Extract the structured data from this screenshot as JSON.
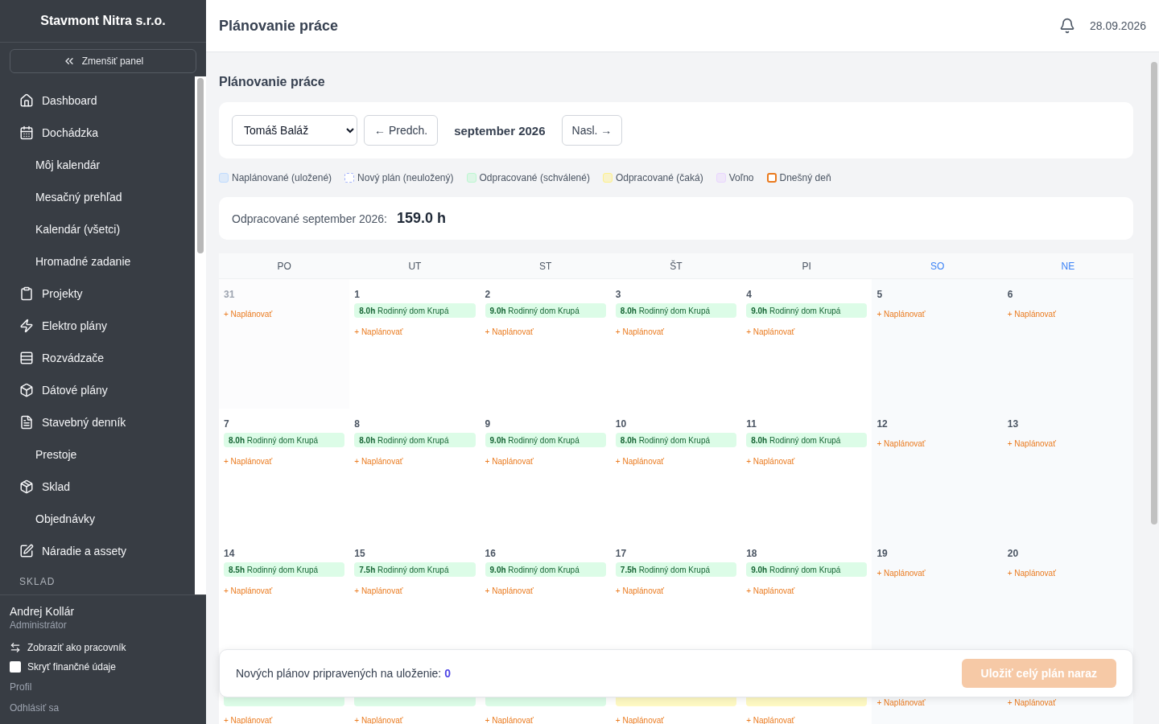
{
  "sidebar": {
    "company": "Stavmont Nitra s.r.o.",
    "collapse_button": "Zmenšiť panel",
    "items": [
      {
        "label": "Dashboard",
        "kind": "main"
      },
      {
        "label": "Dochádzka",
        "kind": "main"
      },
      {
        "label": "Môj kalendár",
        "kind": "sub"
      },
      {
        "label": "Mesačný prehľad",
        "kind": "sub"
      },
      {
        "label": "Kalendár (všetci)",
        "kind": "sub"
      },
      {
        "label": "Hromadné zadanie",
        "kind": "sub"
      },
      {
        "label": "Projekty",
        "kind": "main"
      },
      {
        "label": "Elektro plány",
        "kind": "main"
      },
      {
        "label": "Rozvádzače",
        "kind": "main"
      },
      {
        "label": "Dátové plány",
        "kind": "main"
      },
      {
        "label": "Stavebný denník",
        "kind": "main"
      },
      {
        "label": "Prestoje",
        "kind": "sub"
      },
      {
        "label": "Sklad",
        "kind": "main"
      },
      {
        "label": "Objednávky",
        "kind": "sub"
      },
      {
        "label": "Náradie a assety",
        "kind": "main"
      },
      {
        "label": "SKLAD",
        "kind": "section"
      }
    ],
    "user": {
      "name": "Andrej Kollár",
      "role": "Administrátor",
      "switch_link": "Zobraziť ako pracovník",
      "hide_finance": {
        "label": "Skryť finančné údaje",
        "checked": false
      },
      "links": [
        "Profil",
        "Odhlásiť sa"
      ]
    }
  },
  "header": {
    "title": "Plánovanie práce",
    "date": "28.09.2026"
  },
  "page_title": "Plánovanie práce",
  "toolbar": {
    "employee": "Tomáš Baláž",
    "prev_button": "← Predch.",
    "month": "september 2026",
    "next_button": "Nasl. →"
  },
  "legend": [
    {
      "label": "Naplánované (uložené)",
      "color": "#bfdbfe",
      "kind": "solid"
    },
    {
      "label": "Nový plán (neuložený)",
      "color": "#a5b4fc",
      "kind": "dashed"
    },
    {
      "label": "Odpracované (schválené)",
      "color": "#bbf7d0",
      "kind": "solid"
    },
    {
      "label": "Odpracované (čaká)",
      "color": "#fef08a",
      "kind": "solid"
    },
    {
      "label": "Voľno",
      "color": "#e9d5ff",
      "kind": "solid"
    },
    {
      "label": "Dnešný deň",
      "color": "#ea7a1e",
      "kind": "outline"
    }
  ],
  "summary": {
    "label": "Odpracované september 2026:",
    "value": "159.0 h"
  },
  "calendar": {
    "weekdays": [
      {
        "label": "PO",
        "weekend": false
      },
      {
        "label": "UT",
        "weekend": false
      },
      {
        "label": "ST",
        "weekend": false
      },
      {
        "label": "ŠT",
        "weekend": false
      },
      {
        "label": "PI",
        "weekend": false
      },
      {
        "label": "SO",
        "weekend": true
      },
      {
        "label": "NE",
        "weekend": true
      }
    ],
    "weeks": [
      [
        {
          "day": "31",
          "other_month": true,
          "add": "+ Naplánovať"
        },
        {
          "day": "1",
          "other_month": false,
          "entries": [
            {
              "text": "**8.0h** Rodinný dom Krupá",
              "kind": "approved"
            }
          ],
          "add": "+ Naplánovať"
        },
        {
          "day": "2",
          "other_month": false,
          "entries": [
            {
              "text": "**9.0h** Rodinný dom Krupá",
              "kind": "approved"
            }
          ],
          "add": "+ Naplánovať"
        },
        {
          "day": "3",
          "other_month": false,
          "entries": [
            {
              "text": "**8.0h** Rodinný dom Krupá",
              "kind": "approved"
            }
          ],
          "add": "+ Naplánovať"
        },
        {
          "day": "4",
          "other_month": false,
          "entries": [
            {
              "text": "**9.0h** Rodinný dom Krupá",
              "kind": "approved"
            }
          ],
          "add": "+ Naplánovať"
        },
        {
          "day": "5",
          "other_month": false,
          "add": "+ Naplánovať"
        },
        {
          "day": "6",
          "other_month": false,
          "add": "+ Naplánovať"
        }
      ],
      [
        {
          "day": "7",
          "other_month": false,
          "entries": [
            {
              "text": "**8.0h** Rodinný dom Krupá",
              "kind": "approved"
            }
          ],
          "add": "+ Naplánovať"
        },
        {
          "day": "8",
          "other_month": false,
          "entries": [
            {
              "text": "**8.0h** Rodinný dom Krupá",
              "kind": "approved"
            }
          ],
          "add": "+ Naplánovať"
        },
        {
          "day": "9",
          "other_month": false,
          "entries": [
            {
              "text": "**9.0h** Rodinný dom Krupá",
              "kind": "approved"
            }
          ],
          "add": "+ Naplánovať"
        },
        {
          "day": "10",
          "other_month": false,
          "entries": [
            {
              "text": "**8.0h** Rodinný dom Krupá",
              "kind": "approved"
            }
          ],
          "add": "+ Naplánovať"
        },
        {
          "day": "11",
          "other_month": false,
          "entries": [
            {
              "text": "**8.0h** Rodinný dom Krupá",
              "kind": "approved"
            }
          ],
          "add": "+ Naplánovať"
        },
        {
          "day": "12",
          "other_month": false,
          "add": "+ Naplánovať"
        },
        {
          "day": "13",
          "other_month": false,
          "add": "+ Naplánovať"
        }
      ],
      [
        {
          "day": "14",
          "other_month": false,
          "entries": [
            {
              "text": "**8.5h** Rodinný dom Krupá",
              "kind": "approved"
            }
          ],
          "add": "+ Naplánovať"
        },
        {
          "day": "15",
          "other_month": false,
          "entries": [
            {
              "text": "**7.5h** Rodinný dom Krupá",
              "kind": "approved"
            }
          ],
          "add": "+ Naplánovať"
        },
        {
          "day": "16",
          "other_month": false,
          "entries": [
            {
              "text": "**9.0h** Rodinný dom Krupá",
              "kind": "approved"
            }
          ],
          "add": "+ Naplánovať"
        },
        {
          "day": "17",
          "other_month": false,
          "entries": [
            {
              "text": "**7.5h** Rodinný dom Krupá",
              "kind": "approved"
            }
          ],
          "add": "+ Naplánovať"
        },
        {
          "day": "18",
          "other_month": false,
          "entries": [
            {
              "text": "**9.0h** Rodinný dom Krupá",
              "kind": "approved"
            }
          ],
          "add": "+ Naplánovať"
        },
        {
          "day": "19",
          "other_month": false,
          "add": "+ Naplánovať"
        },
        {
          "day": "20",
          "other_month": false,
          "add": "+ Naplánovať"
        }
      ],
      [
        {
          "entries": [
            {
              "kind": "approved"
            }
          ],
          "add": "+ Naplánovať"
        },
        {
          "entries": [
            {
              "kind": "approved"
            }
          ],
          "add": "+ Naplánovať"
        },
        {
          "entries": [
            {
              "kind": "approved"
            }
          ],
          "add": "+ Naplánovať"
        },
        {
          "entries": [
            {
              "kind": "pending"
            }
          ],
          "add": "+ Naplánovať"
        },
        {
          "entries": [
            {
              "kind": "pending"
            }
          ],
          "add": "+ Naplánovať"
        },
        {
          "add": "+ Naplánovať"
        },
        {
          "add": "+ Naplánovať"
        }
      ]
    ]
  },
  "save_bar": {
    "label": "Nových plánov pripravených na uloženie:",
    "count": "0",
    "button": {
      "label": "Uložiť celý plán naraz",
      "disabled": true
    }
  }
}
